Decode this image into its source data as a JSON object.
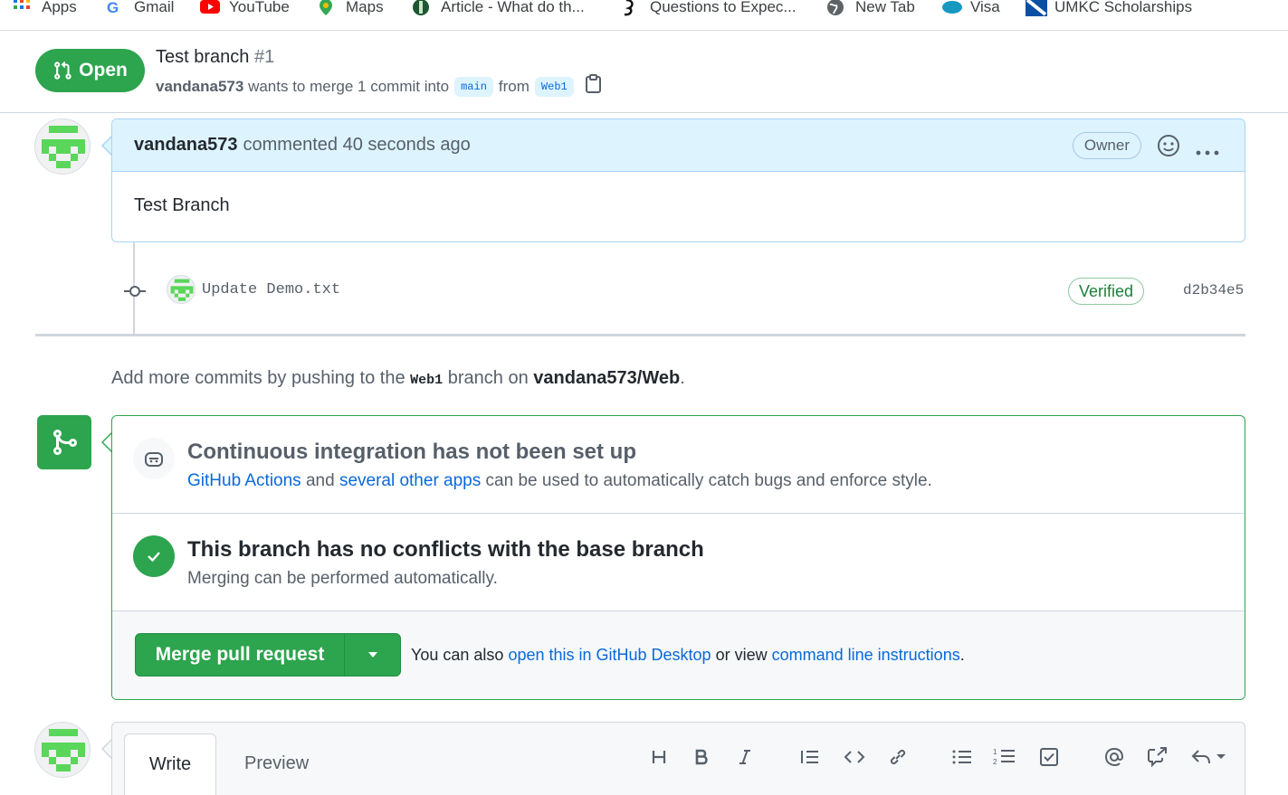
{
  "bookmarks": [
    {
      "label": "Apps",
      "icon": "apps-grid-icon"
    },
    {
      "label": "Gmail",
      "icon": "google-icon"
    },
    {
      "label": "YouTube",
      "icon": "youtube-icon"
    },
    {
      "label": "Maps",
      "icon": "maps-pin-icon"
    },
    {
      "label": "Article - What do th...",
      "icon": "article-icon"
    },
    {
      "label": "Questions to Expec...",
      "icon": "questions-icon"
    },
    {
      "label": "New Tab",
      "icon": "globe-icon"
    },
    {
      "label": "Visa",
      "icon": "cloud-icon"
    },
    {
      "label": "UMKC Scholarships",
      "icon": "umkc-icon"
    }
  ],
  "pr": {
    "state": "Open",
    "title": "Test branch",
    "number": "#1",
    "author": "vandana573",
    "meta_text": "wants to merge 1 commit into",
    "base_branch": "main",
    "from_text": "from",
    "head_branch": "Web1"
  },
  "comment": {
    "author": "vandana573",
    "action": "commented 40 seconds ago",
    "badge": "Owner",
    "body": "Test Branch"
  },
  "commit": {
    "message": "Update Demo.txt",
    "verified": "Verified",
    "sha": "d2b34e5"
  },
  "add_more": {
    "prefix": "Add more commits by pushing to the",
    "branch": "Web1",
    "middle": "branch on",
    "repo": "vandana573/Web",
    "suffix": "."
  },
  "merge_box": {
    "ci_title": "Continuous integration has not been set up",
    "ci_link1": "GitHub Actions",
    "ci_and": "and",
    "ci_link2": "several other apps",
    "ci_rest": "can be used to automatically catch bugs and enforce style.",
    "conflict_title": "This branch has no conflicts with the base branch",
    "conflict_sub": "Merging can be performed automatically.",
    "merge_button": "Merge pull request",
    "also_prefix": "You can also",
    "also_link1": "open this in GitHub Desktop",
    "also_mid": "or view",
    "also_link2": "command line instructions",
    "also_suffix": "."
  },
  "editor": {
    "tab_write": "Write",
    "tab_preview": "Preview",
    "toolbar": [
      "heading-icon",
      "bold-icon",
      "italic-icon",
      "quote-icon",
      "code-icon",
      "link-icon",
      "unordered-list-icon",
      "ordered-list-icon",
      "task-list-icon",
      "mention-icon",
      "cross-reference-icon",
      "reply-icon"
    ]
  },
  "colors": {
    "green": "#2da44e",
    "blue_link": "#0969da",
    "comment_header_bg": "#ddf4ff"
  }
}
